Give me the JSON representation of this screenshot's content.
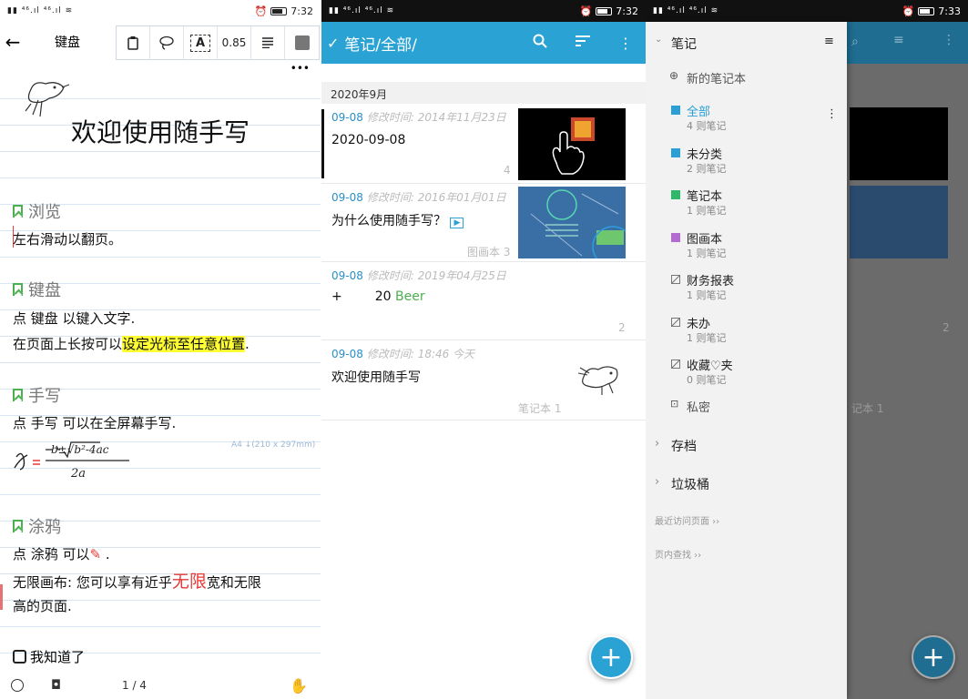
{
  "panel1": {
    "status": {
      "time": "7:32"
    },
    "toolbar": {
      "title": "键盘",
      "zoom": "0.85",
      "font_tool": "A",
      "more": "•••"
    },
    "doc": {
      "title": "欢迎使用随手写",
      "sections": [
        {
          "heading": "浏览",
          "lines": [
            "左右滑动以翻页。"
          ]
        },
        {
          "heading": "键盘",
          "lines": [
            "点 键盘 以键入文字.",
            "在页面上长按可以",
            "设定光标至任意位置",
            "."
          ]
        },
        {
          "heading": "手写",
          "lines": [
            "点 手写 可以在全屏幕手写."
          ]
        },
        {
          "heading": "涂鸦",
          "lines": [
            "点 涂鸦 可以",
            " .",
            "无限画布: 您可以享有近乎",
            "无限",
            "宽和无限",
            "高的页面."
          ]
        }
      ],
      "paper_size": "A4 ↓(210 x 297mm)",
      "checkbox_label": "我知道了"
    },
    "footer": {
      "page": "1 / 4"
    }
  },
  "panel2": {
    "status": {
      "time": "7:32"
    },
    "toolbar": {
      "title": "笔记/全部/"
    },
    "group": "2020年9月",
    "notes": [
      {
        "date": "09-08",
        "modified": "修改时间: 2014年11月23日",
        "title": "2020-09-08",
        "meta": "4"
      },
      {
        "date": "09-08",
        "modified": "修改时间: 2016年01月01日",
        "title": "为什么使用随手写？",
        "meta": "图画本 3"
      },
      {
        "date": "09-08",
        "modified": "修改时间: 2019年04月25日",
        "title_prefix": "+",
        "title_num": "20",
        "title_word": "Beer",
        "meta": "2"
      },
      {
        "date": "09-08",
        "modified": "修改时间: 18:46 今天",
        "title": "欢迎使用随手写",
        "meta": "笔记本 1"
      }
    ],
    "fab": "+"
  },
  "panel3": {
    "status": {
      "time": "7:33"
    },
    "drawer": {
      "header": "笔记",
      "new_notebook": "新的笔记本",
      "items": [
        {
          "name": "全部",
          "count": "4 则笔记",
          "color": "#2a9fd6",
          "active": true
        },
        {
          "name": "未分类",
          "count": "2 则笔记",
          "color": "#2a9fd6"
        },
        {
          "name": "笔记本",
          "count": "1 则笔记",
          "color": "#2eb86a"
        },
        {
          "name": "图画本",
          "count": "1 则笔记",
          "color": "#b36ad1"
        },
        {
          "name": "财务报表",
          "count": "1 则笔记",
          "color": "outline"
        },
        {
          "name": "未办",
          "count": "1 则笔记",
          "color": "outline"
        },
        {
          "name": "收藏♡夹",
          "count": "0 则笔记",
          "color": "outline"
        }
      ],
      "private": "私密",
      "archive": "存档",
      "trash": "垃圾桶",
      "recent": "最近访问页面 ››",
      "find": "页内查找 ››"
    },
    "behind": {
      "meta1": "2",
      "meta2": "记本 1"
    },
    "fab": "+"
  }
}
